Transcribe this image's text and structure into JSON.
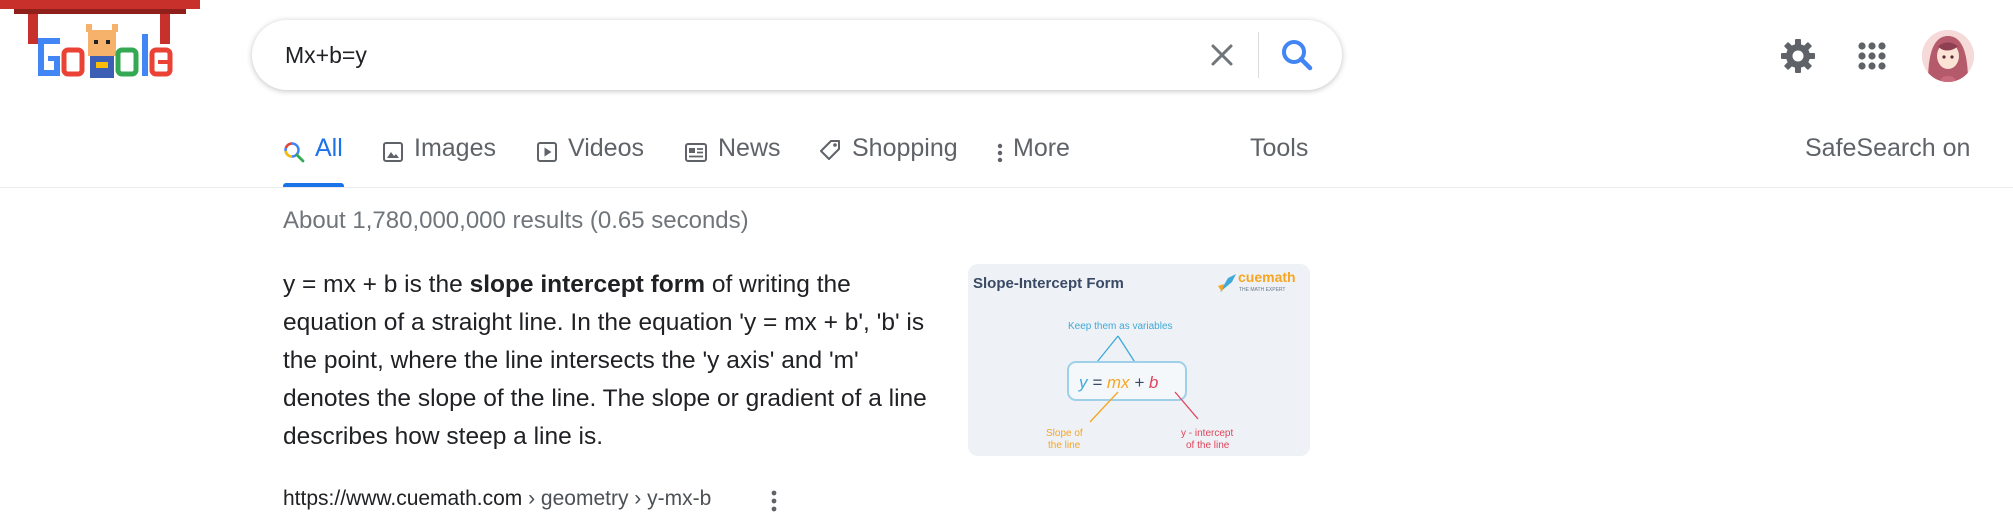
{
  "search": {
    "query": "Mx+b=y"
  },
  "logo": {
    "alt": "Google"
  },
  "tabs": [
    {
      "label": "All",
      "icon": "search-icon",
      "active": true
    },
    {
      "label": "Images",
      "icon": "image-icon"
    },
    {
      "label": "Videos",
      "icon": "play-icon"
    },
    {
      "label": "News",
      "icon": "news-icon"
    },
    {
      "label": "Shopping",
      "icon": "tag-icon"
    },
    {
      "label": "More",
      "icon": "more-vertical-icon"
    }
  ],
  "tools_label": "Tools",
  "safesearch_label": "SafeSearch on",
  "results": {
    "stats": "About 1,780,000,000 results (0.65 seconds)",
    "snippet": {
      "before": "y = mx + b is the ",
      "bold": "slope intercept form",
      "after": " of writing the equation of a straight line. In the equation 'y = mx + b', 'b' is the point, where the line intersects the 'y axis' and 'm' denotes the slope of the line. The slope or gradient of a line describes how steep a line is."
    },
    "thumbnail": {
      "title": "Slope-Intercept Form",
      "brand": "cuemath",
      "brand_tagline": "THE MATH EXPERT",
      "note_top": "Keep them as variables",
      "formula_y": "y",
      "formula_eq": " = ",
      "formula_mx": "mx",
      "formula_plus": " + ",
      "formula_b": "b",
      "label_slope_1": "Slope of",
      "label_slope_2": "the line",
      "label_int_1": "y - intercept",
      "label_int_2": "of the line"
    },
    "cite": {
      "domain": "https://www.cuemath.com",
      "path": " › geometry › y-mx-b"
    }
  },
  "colors": {
    "accent": "#1a73e8",
    "brand_teal": "#3fa9d9",
    "brand_orange": "#f6a623",
    "brand_red": "#e0445b"
  }
}
